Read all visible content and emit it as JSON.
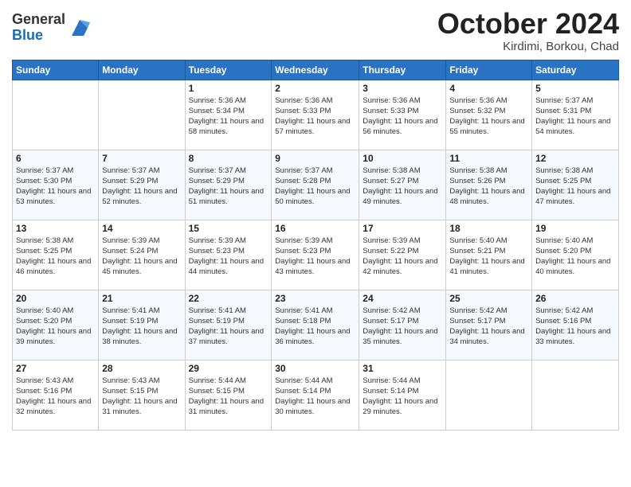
{
  "header": {
    "logo_general": "General",
    "logo_blue": "Blue",
    "month": "October 2024",
    "location": "Kirdimi, Borkou, Chad"
  },
  "weekdays": [
    "Sunday",
    "Monday",
    "Tuesday",
    "Wednesday",
    "Thursday",
    "Friday",
    "Saturday"
  ],
  "weeks": [
    [
      {
        "day": "",
        "info": ""
      },
      {
        "day": "",
        "info": ""
      },
      {
        "day": "1",
        "info": "Sunrise: 5:36 AM\nSunset: 5:34 PM\nDaylight: 11 hours and 58 minutes."
      },
      {
        "day": "2",
        "info": "Sunrise: 5:36 AM\nSunset: 5:33 PM\nDaylight: 11 hours and 57 minutes."
      },
      {
        "day": "3",
        "info": "Sunrise: 5:36 AM\nSunset: 5:33 PM\nDaylight: 11 hours and 56 minutes."
      },
      {
        "day": "4",
        "info": "Sunrise: 5:36 AM\nSunset: 5:32 PM\nDaylight: 11 hours and 55 minutes."
      },
      {
        "day": "5",
        "info": "Sunrise: 5:37 AM\nSunset: 5:31 PM\nDaylight: 11 hours and 54 minutes."
      }
    ],
    [
      {
        "day": "6",
        "info": "Sunrise: 5:37 AM\nSunset: 5:30 PM\nDaylight: 11 hours and 53 minutes."
      },
      {
        "day": "7",
        "info": "Sunrise: 5:37 AM\nSunset: 5:29 PM\nDaylight: 11 hours and 52 minutes."
      },
      {
        "day": "8",
        "info": "Sunrise: 5:37 AM\nSunset: 5:29 PM\nDaylight: 11 hours and 51 minutes."
      },
      {
        "day": "9",
        "info": "Sunrise: 5:37 AM\nSunset: 5:28 PM\nDaylight: 11 hours and 50 minutes."
      },
      {
        "day": "10",
        "info": "Sunrise: 5:38 AM\nSunset: 5:27 PM\nDaylight: 11 hours and 49 minutes."
      },
      {
        "day": "11",
        "info": "Sunrise: 5:38 AM\nSunset: 5:26 PM\nDaylight: 11 hours and 48 minutes."
      },
      {
        "day": "12",
        "info": "Sunrise: 5:38 AM\nSunset: 5:25 PM\nDaylight: 11 hours and 47 minutes."
      }
    ],
    [
      {
        "day": "13",
        "info": "Sunrise: 5:38 AM\nSunset: 5:25 PM\nDaylight: 11 hours and 46 minutes."
      },
      {
        "day": "14",
        "info": "Sunrise: 5:39 AM\nSunset: 5:24 PM\nDaylight: 11 hours and 45 minutes."
      },
      {
        "day": "15",
        "info": "Sunrise: 5:39 AM\nSunset: 5:23 PM\nDaylight: 11 hours and 44 minutes."
      },
      {
        "day": "16",
        "info": "Sunrise: 5:39 AM\nSunset: 5:23 PM\nDaylight: 11 hours and 43 minutes."
      },
      {
        "day": "17",
        "info": "Sunrise: 5:39 AM\nSunset: 5:22 PM\nDaylight: 11 hours and 42 minutes."
      },
      {
        "day": "18",
        "info": "Sunrise: 5:40 AM\nSunset: 5:21 PM\nDaylight: 11 hours and 41 minutes."
      },
      {
        "day": "19",
        "info": "Sunrise: 5:40 AM\nSunset: 5:20 PM\nDaylight: 11 hours and 40 minutes."
      }
    ],
    [
      {
        "day": "20",
        "info": "Sunrise: 5:40 AM\nSunset: 5:20 PM\nDaylight: 11 hours and 39 minutes."
      },
      {
        "day": "21",
        "info": "Sunrise: 5:41 AM\nSunset: 5:19 PM\nDaylight: 11 hours and 38 minutes."
      },
      {
        "day": "22",
        "info": "Sunrise: 5:41 AM\nSunset: 5:19 PM\nDaylight: 11 hours and 37 minutes."
      },
      {
        "day": "23",
        "info": "Sunrise: 5:41 AM\nSunset: 5:18 PM\nDaylight: 11 hours and 36 minutes."
      },
      {
        "day": "24",
        "info": "Sunrise: 5:42 AM\nSunset: 5:17 PM\nDaylight: 11 hours and 35 minutes."
      },
      {
        "day": "25",
        "info": "Sunrise: 5:42 AM\nSunset: 5:17 PM\nDaylight: 11 hours and 34 minutes."
      },
      {
        "day": "26",
        "info": "Sunrise: 5:42 AM\nSunset: 5:16 PM\nDaylight: 11 hours and 33 minutes."
      }
    ],
    [
      {
        "day": "27",
        "info": "Sunrise: 5:43 AM\nSunset: 5:16 PM\nDaylight: 11 hours and 32 minutes."
      },
      {
        "day": "28",
        "info": "Sunrise: 5:43 AM\nSunset: 5:15 PM\nDaylight: 11 hours and 31 minutes."
      },
      {
        "day": "29",
        "info": "Sunrise: 5:44 AM\nSunset: 5:15 PM\nDaylight: 11 hours and 31 minutes."
      },
      {
        "day": "30",
        "info": "Sunrise: 5:44 AM\nSunset: 5:14 PM\nDaylight: 11 hours and 30 minutes."
      },
      {
        "day": "31",
        "info": "Sunrise: 5:44 AM\nSunset: 5:14 PM\nDaylight: 11 hours and 29 minutes."
      },
      {
        "day": "",
        "info": ""
      },
      {
        "day": "",
        "info": ""
      }
    ]
  ]
}
